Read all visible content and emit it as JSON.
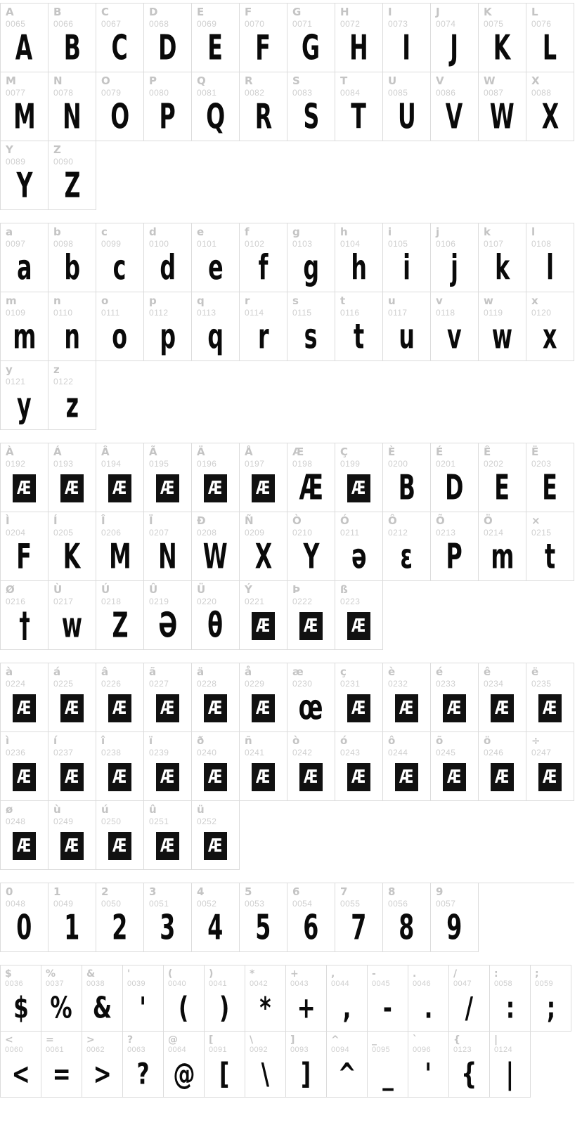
{
  "page": {
    "type": "font-character-map",
    "background": "#ffffff",
    "grid_line_color": "#dcdcdc",
    "label_color": "#c4c4c4",
    "code_color": "#cfcfcf",
    "glyph_color": "#0a0a0a"
  },
  "sections": [
    {
      "name": "uppercase-latin",
      "columns": 12,
      "cells": [
        {
          "char": "A",
          "code": "0065",
          "glyph": "A",
          "missing": false
        },
        {
          "char": "B",
          "code": "0066",
          "glyph": "B",
          "missing": false
        },
        {
          "char": "C",
          "code": "0067",
          "glyph": "C",
          "missing": false
        },
        {
          "char": "D",
          "code": "0068",
          "glyph": "D",
          "missing": false
        },
        {
          "char": "E",
          "code": "0069",
          "glyph": "E",
          "missing": false
        },
        {
          "char": "F",
          "code": "0070",
          "glyph": "F",
          "missing": false
        },
        {
          "char": "G",
          "code": "0071",
          "glyph": "G",
          "missing": false
        },
        {
          "char": "H",
          "code": "0072",
          "glyph": "H",
          "missing": false
        },
        {
          "char": "I",
          "code": "0073",
          "glyph": "I",
          "missing": false
        },
        {
          "char": "J",
          "code": "0074",
          "glyph": "J",
          "missing": false
        },
        {
          "char": "K",
          "code": "0075",
          "glyph": "K",
          "missing": false
        },
        {
          "char": "L",
          "code": "0076",
          "glyph": "L",
          "missing": false
        },
        {
          "char": "M",
          "code": "0077",
          "glyph": "M",
          "missing": false
        },
        {
          "char": "N",
          "code": "0078",
          "glyph": "N",
          "missing": false
        },
        {
          "char": "O",
          "code": "0079",
          "glyph": "O",
          "missing": false
        },
        {
          "char": "P",
          "code": "0080",
          "glyph": "P",
          "missing": false
        },
        {
          "char": "Q",
          "code": "0081",
          "glyph": "Q",
          "missing": false
        },
        {
          "char": "R",
          "code": "0082",
          "glyph": "R",
          "missing": false
        },
        {
          "char": "S",
          "code": "0083",
          "glyph": "S",
          "missing": false
        },
        {
          "char": "T",
          "code": "0084",
          "glyph": "T",
          "missing": false
        },
        {
          "char": "U",
          "code": "0085",
          "glyph": "U",
          "missing": false
        },
        {
          "char": "V",
          "code": "0086",
          "glyph": "V",
          "missing": false
        },
        {
          "char": "W",
          "code": "0087",
          "glyph": "W",
          "missing": false
        },
        {
          "char": "X",
          "code": "0088",
          "glyph": "X",
          "missing": false
        },
        {
          "char": "Y",
          "code": "0089",
          "glyph": "Y",
          "missing": false
        },
        {
          "char": "Z",
          "code": "0090",
          "glyph": "Z",
          "missing": false
        }
      ]
    },
    {
      "name": "lowercase-latin",
      "columns": 12,
      "cells": [
        {
          "char": "a",
          "code": "0097",
          "glyph": "a",
          "missing": false
        },
        {
          "char": "b",
          "code": "0098",
          "glyph": "b",
          "missing": false
        },
        {
          "char": "c",
          "code": "0099",
          "glyph": "c",
          "missing": false
        },
        {
          "char": "d",
          "code": "0100",
          "glyph": "d",
          "missing": false
        },
        {
          "char": "e",
          "code": "0101",
          "glyph": "e",
          "missing": false
        },
        {
          "char": "f",
          "code": "0102",
          "glyph": "f",
          "missing": false
        },
        {
          "char": "g",
          "code": "0103",
          "glyph": "g",
          "missing": false
        },
        {
          "char": "h",
          "code": "0104",
          "glyph": "h",
          "missing": false
        },
        {
          "char": "i",
          "code": "0105",
          "glyph": "i",
          "missing": false
        },
        {
          "char": "j",
          "code": "0106",
          "glyph": "j",
          "missing": false
        },
        {
          "char": "k",
          "code": "0107",
          "glyph": "k",
          "missing": false
        },
        {
          "char": "l",
          "code": "0108",
          "glyph": "l",
          "missing": false
        },
        {
          "char": "m",
          "code": "0109",
          "glyph": "m",
          "missing": false
        },
        {
          "char": "n",
          "code": "0110",
          "glyph": "n",
          "missing": false
        },
        {
          "char": "o",
          "code": "0111",
          "glyph": "o",
          "missing": false
        },
        {
          "char": "p",
          "code": "0112",
          "glyph": "p",
          "missing": false
        },
        {
          "char": "q",
          "code": "0113",
          "glyph": "q",
          "missing": false
        },
        {
          "char": "r",
          "code": "0114",
          "glyph": "r",
          "missing": false
        },
        {
          "char": "s",
          "code": "0115",
          "glyph": "s",
          "missing": false
        },
        {
          "char": "t",
          "code": "0116",
          "glyph": "t",
          "missing": false
        },
        {
          "char": "u",
          "code": "0117",
          "glyph": "u",
          "missing": false
        },
        {
          "char": "v",
          "code": "0118",
          "glyph": "v",
          "missing": false
        },
        {
          "char": "w",
          "code": "0119",
          "glyph": "w",
          "missing": false
        },
        {
          "char": "x",
          "code": "0120",
          "glyph": "x",
          "missing": false
        },
        {
          "char": "y",
          "code": "0121",
          "glyph": "y",
          "missing": false
        },
        {
          "char": "z",
          "code": "0122",
          "glyph": "z",
          "missing": false
        }
      ]
    },
    {
      "name": "accented-uppercase",
      "columns": 12,
      "cells": [
        {
          "char": "À",
          "code": "0192",
          "glyph": "",
          "missing": true
        },
        {
          "char": "Á",
          "code": "0193",
          "glyph": "",
          "missing": true
        },
        {
          "char": "Â",
          "code": "0194",
          "glyph": "",
          "missing": true
        },
        {
          "char": "Ã",
          "code": "0195",
          "glyph": "",
          "missing": true
        },
        {
          "char": "Ä",
          "code": "0196",
          "glyph": "",
          "missing": true
        },
        {
          "char": "Å",
          "code": "0197",
          "glyph": "",
          "missing": true
        },
        {
          "char": "Æ",
          "code": "0198",
          "glyph": "Æ",
          "missing": false
        },
        {
          "char": "Ç",
          "code": "0199",
          "glyph": "",
          "missing": true
        },
        {
          "char": "È",
          "code": "0200",
          "glyph": "B",
          "missing": false
        },
        {
          "char": "É",
          "code": "0201",
          "glyph": "D",
          "missing": false
        },
        {
          "char": "Ê",
          "code": "0202",
          "glyph": "E",
          "missing": false
        },
        {
          "char": "Ë",
          "code": "0203",
          "glyph": "E",
          "missing": false
        },
        {
          "char": "Ì",
          "code": "0204",
          "glyph": "F",
          "missing": false
        },
        {
          "char": "Í",
          "code": "0205",
          "glyph": "K",
          "missing": false
        },
        {
          "char": "Î",
          "code": "0206",
          "glyph": "M",
          "missing": false
        },
        {
          "char": "Ï",
          "code": "0207",
          "glyph": "N",
          "missing": false
        },
        {
          "char": "Ð",
          "code": "0208",
          "glyph": "W",
          "missing": false
        },
        {
          "char": "Ñ",
          "code": "0209",
          "glyph": "X",
          "missing": false
        },
        {
          "char": "Ò",
          "code": "0210",
          "glyph": "Y",
          "missing": false
        },
        {
          "char": "Ó",
          "code": "0211",
          "glyph": "ə",
          "missing": false
        },
        {
          "char": "Ô",
          "code": "0212",
          "glyph": "ɛ",
          "missing": false
        },
        {
          "char": "Õ",
          "code": "0213",
          "glyph": "P",
          "missing": false
        },
        {
          "char": "Ö",
          "code": "0214",
          "glyph": "m",
          "missing": false
        },
        {
          "char": "×",
          "code": "0215",
          "glyph": "t",
          "missing": false
        },
        {
          "char": "Ø",
          "code": "0216",
          "glyph": "†",
          "missing": false
        },
        {
          "char": "Ù",
          "code": "0217",
          "glyph": "w",
          "missing": false
        },
        {
          "char": "Ú",
          "code": "0218",
          "glyph": "Z",
          "missing": false
        },
        {
          "char": "Û",
          "code": "0219",
          "glyph": "Ə",
          "missing": false
        },
        {
          "char": "Ü",
          "code": "0220",
          "glyph": "θ",
          "missing": false
        },
        {
          "char": "Ý",
          "code": "0221",
          "glyph": "",
          "missing": true
        },
        {
          "char": "Þ",
          "code": "0222",
          "glyph": "",
          "missing": true
        },
        {
          "char": "ß",
          "code": "0223",
          "glyph": "",
          "missing": true
        }
      ]
    },
    {
      "name": "accented-lowercase",
      "columns": 12,
      "cells": [
        {
          "char": "à",
          "code": "0224",
          "glyph": "",
          "missing": true
        },
        {
          "char": "á",
          "code": "0225",
          "glyph": "",
          "missing": true
        },
        {
          "char": "â",
          "code": "0226",
          "glyph": "",
          "missing": true
        },
        {
          "char": "ã",
          "code": "0227",
          "glyph": "",
          "missing": true
        },
        {
          "char": "ä",
          "code": "0228",
          "glyph": "",
          "missing": true
        },
        {
          "char": "å",
          "code": "0229",
          "glyph": "",
          "missing": true
        },
        {
          "char": "æ",
          "code": "0230",
          "glyph": "œ",
          "missing": false
        },
        {
          "char": "ç",
          "code": "0231",
          "glyph": "",
          "missing": true
        },
        {
          "char": "è",
          "code": "0232",
          "glyph": "",
          "missing": true
        },
        {
          "char": "é",
          "code": "0233",
          "glyph": "",
          "missing": true
        },
        {
          "char": "ê",
          "code": "0234",
          "glyph": "",
          "missing": true
        },
        {
          "char": "ë",
          "code": "0235",
          "glyph": "",
          "missing": true
        },
        {
          "char": "ì",
          "code": "0236",
          "glyph": "",
          "missing": true
        },
        {
          "char": "í",
          "code": "0237",
          "glyph": "",
          "missing": true
        },
        {
          "char": "î",
          "code": "0238",
          "glyph": "",
          "missing": true
        },
        {
          "char": "ï",
          "code": "0239",
          "glyph": "",
          "missing": true
        },
        {
          "char": "ð",
          "code": "0240",
          "glyph": "",
          "missing": true
        },
        {
          "char": "ñ",
          "code": "0241",
          "glyph": "",
          "missing": true
        },
        {
          "char": "ò",
          "code": "0242",
          "glyph": "",
          "missing": true
        },
        {
          "char": "ó",
          "code": "0243",
          "glyph": "",
          "missing": true
        },
        {
          "char": "ô",
          "code": "0244",
          "glyph": "",
          "missing": true
        },
        {
          "char": "õ",
          "code": "0245",
          "glyph": "",
          "missing": true
        },
        {
          "char": "ö",
          "code": "0246",
          "glyph": "",
          "missing": true
        },
        {
          "char": "÷",
          "code": "0247",
          "glyph": "",
          "missing": true
        },
        {
          "char": "ø",
          "code": "0248",
          "glyph": "",
          "missing": true
        },
        {
          "char": "ù",
          "code": "0249",
          "glyph": "",
          "missing": true
        },
        {
          "char": "ú",
          "code": "0250",
          "glyph": "",
          "missing": true
        },
        {
          "char": "û",
          "code": "0251",
          "glyph": "",
          "missing": true
        },
        {
          "char": "ü",
          "code": "0252",
          "glyph": "",
          "missing": true
        }
      ]
    },
    {
      "name": "digits",
      "columns": 12,
      "cells": [
        {
          "char": "0",
          "code": "0048",
          "glyph": "0",
          "missing": false
        },
        {
          "char": "1",
          "code": "0049",
          "glyph": "1",
          "missing": false
        },
        {
          "char": "2",
          "code": "0050",
          "glyph": "2",
          "missing": false
        },
        {
          "char": "3",
          "code": "0051",
          "glyph": "3",
          "missing": false
        },
        {
          "char": "4",
          "code": "0052",
          "glyph": "4",
          "missing": false
        },
        {
          "char": "5",
          "code": "0053",
          "glyph": "5",
          "missing": false
        },
        {
          "char": "6",
          "code": "0054",
          "glyph": "6",
          "missing": false
        },
        {
          "char": "7",
          "code": "0055",
          "glyph": "7",
          "missing": false
        },
        {
          "char": "8",
          "code": "0056",
          "glyph": "8",
          "missing": false
        },
        {
          "char": "9",
          "code": "0057",
          "glyph": "9",
          "missing": false
        }
      ]
    },
    {
      "name": "punctuation-symbols",
      "columns": 14,
      "cells": [
        {
          "char": "$",
          "code": "0036",
          "glyph": "$",
          "missing": false
        },
        {
          "char": "%",
          "code": "0037",
          "glyph": "%",
          "missing": false
        },
        {
          "char": "&",
          "code": "0038",
          "glyph": "&",
          "missing": false
        },
        {
          "char": "'",
          "code": "0039",
          "glyph": "'",
          "missing": false
        },
        {
          "char": "(",
          "code": "0040",
          "glyph": "(",
          "missing": false
        },
        {
          "char": ")",
          "code": "0041",
          "glyph": ")",
          "missing": false
        },
        {
          "char": "*",
          "code": "0042",
          "glyph": "*",
          "missing": false
        },
        {
          "char": "+",
          "code": "0043",
          "glyph": "+",
          "missing": false
        },
        {
          "char": ",",
          "code": "0044",
          "glyph": ",",
          "missing": false
        },
        {
          "char": "-",
          "code": "0045",
          "glyph": "-",
          "missing": false
        },
        {
          "char": ".",
          "code": "0046",
          "glyph": ".",
          "missing": false
        },
        {
          "char": "/",
          "code": "0047",
          "glyph": "/",
          "missing": false
        },
        {
          "char": ":",
          "code": "0058",
          "glyph": ":",
          "missing": false
        },
        {
          "char": ";",
          "code": "0059",
          "glyph": ";",
          "missing": false
        },
        {
          "char": "<",
          "code": "0060",
          "glyph": "<",
          "missing": false
        },
        {
          "char": "=",
          "code": "0061",
          "glyph": "=",
          "missing": false
        },
        {
          "char": ">",
          "code": "0062",
          "glyph": ">",
          "missing": false
        },
        {
          "char": "?",
          "code": "0063",
          "glyph": "?",
          "missing": false
        },
        {
          "char": "@",
          "code": "0064",
          "glyph": "@",
          "missing": false
        },
        {
          "char": "[",
          "code": "0091",
          "glyph": "[",
          "missing": false
        },
        {
          "char": "\\",
          "code": "0092",
          "glyph": "\\",
          "missing": false
        },
        {
          "char": "]",
          "code": "0093",
          "glyph": "]",
          "missing": false
        },
        {
          "char": "^",
          "code": "0094",
          "glyph": "^",
          "missing": false
        },
        {
          "char": "_",
          "code": "0095",
          "glyph": "_",
          "missing": false
        },
        {
          "char": "`",
          "code": "0096",
          "glyph": "'",
          "missing": false
        },
        {
          "char": "{",
          "code": "0123",
          "glyph": "{",
          "missing": false
        },
        {
          "char": "|",
          "code": "0124",
          "glyph": "|",
          "missing": false
        }
      ]
    }
  ]
}
